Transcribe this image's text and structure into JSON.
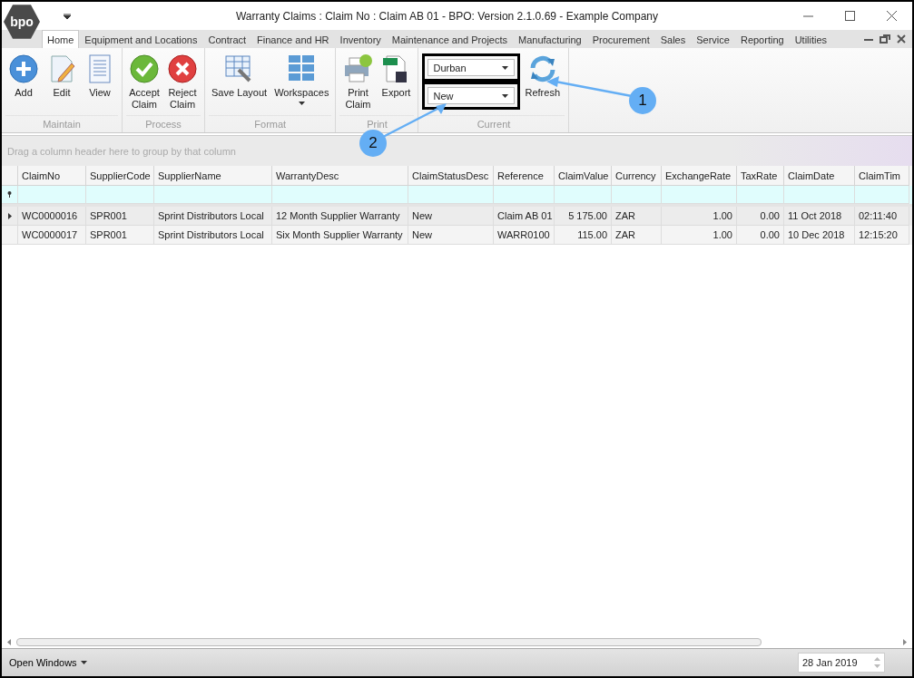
{
  "window": {
    "logo": "bpo",
    "title": "Warranty Claims : Claim No : Claim AB 01 - BPO: Version 2.1.0.69 - Example Company"
  },
  "tabs": [
    {
      "label": "Home",
      "selected": true
    },
    {
      "label": "Equipment and Locations",
      "selected": false
    },
    {
      "label": "Contract",
      "selected": false
    },
    {
      "label": "Finance and HR",
      "selected": false
    },
    {
      "label": "Inventory",
      "selected": false
    },
    {
      "label": "Maintenance and Projects",
      "selected": false
    },
    {
      "label": "Manufacturing",
      "selected": false
    },
    {
      "label": "Procurement",
      "selected": false
    },
    {
      "label": "Sales",
      "selected": false
    },
    {
      "label": "Service",
      "selected": false
    },
    {
      "label": "Reporting",
      "selected": false
    },
    {
      "label": "Utilities",
      "selected": false
    }
  ],
  "ribbon": [
    {
      "name": "Maintain",
      "items": [
        {
          "kind": "button",
          "lines": [
            "Add"
          ]
        },
        {
          "kind": "button",
          "lines": [
            "Edit"
          ]
        },
        {
          "kind": "button",
          "lines": [
            "View"
          ]
        }
      ]
    },
    {
      "name": "Process",
      "items": [
        {
          "kind": "button",
          "lines": [
            "Accept",
            "Claim"
          ]
        },
        {
          "kind": "button",
          "lines": [
            "Reject",
            "Claim"
          ]
        }
      ]
    },
    {
      "name": "Format",
      "items": [
        {
          "kind": "button",
          "lines": [
            "Save Layout"
          ]
        },
        {
          "kind": "button",
          "lines": [
            "Workspaces"
          ],
          "dropdown": true
        }
      ]
    },
    {
      "name": "Print",
      "items": [
        {
          "kind": "button",
          "lines": [
            "Print",
            "Claim"
          ]
        },
        {
          "kind": "button",
          "lines": [
            "Export"
          ]
        }
      ]
    },
    {
      "name": "Current",
      "items": [
        {
          "kind": "combos",
          "highlighted": true,
          "values": [
            "Durban",
            "New"
          ]
        },
        {
          "kind": "button",
          "lines": [
            "Refresh"
          ]
        }
      ]
    }
  ],
  "grid": {
    "group_hint": "Drag a column header here to group by that column",
    "columns": [
      "ClaimNo",
      "SupplierCode",
      "SupplierName",
      "WarrantyDesc",
      "ClaimStatusDesc",
      "Reference",
      "ClaimValue",
      "Currency",
      "ExchangeRate",
      "TaxRate",
      "ClaimDate",
      "ClaimTim"
    ],
    "rows": [
      {
        "selected": true,
        "cells": [
          "WC0000016",
          "SPR001",
          "Sprint Distributors Local",
          "12 Month Supplier Warranty",
          "New",
          "Claim AB 01",
          "5 175.00",
          "ZAR",
          "1.00",
          "0.00",
          "11 Oct 2018",
          "02:11:40"
        ]
      },
      {
        "selected": false,
        "cells": [
          "WC0000017",
          "SPR001",
          "Sprint Distributors Local",
          "Six Month Supplier Warranty",
          "New",
          "WARR0100",
          "115.00",
          "ZAR",
          "1.00",
          "0.00",
          "10 Dec 2018",
          "12:15:20"
        ]
      }
    ]
  },
  "status_bar": {
    "menu": "Open Windows",
    "date": "28 Jan 2019"
  },
  "callouts": [
    {
      "label": "1"
    },
    {
      "label": "2"
    }
  ]
}
